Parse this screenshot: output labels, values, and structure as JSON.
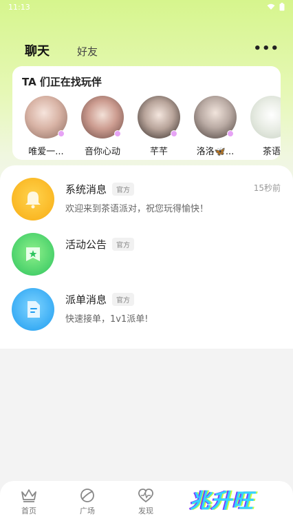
{
  "status_bar": {
    "time": "11:13"
  },
  "tabs": {
    "chat": "聊天",
    "friends": "好友"
  },
  "more_label": "•••",
  "find_card": {
    "title": "TA 们正在找玩伴",
    "people": [
      {
        "name": "唯爱一..."
      },
      {
        "name": "音你心动"
      },
      {
        "name": "芊芊"
      },
      {
        "name": "洛洛🦋..."
      },
      {
        "name": "茶语"
      }
    ]
  },
  "messages": [
    {
      "name": "系统消息",
      "tag": "官方",
      "text": "欢迎来到茶语派对，祝您玩得愉快！",
      "time": "15秒前",
      "icon": "bell-icon",
      "color": "#f8ac13"
    },
    {
      "name": "活动公告",
      "tag": "官方",
      "text": "",
      "time": "",
      "icon": "flag-icon",
      "color": "#2dc45e"
    },
    {
      "name": "派单消息",
      "tag": "官方",
      "text": "快速接单，1v1派单!",
      "time": "",
      "icon": "document-icon",
      "color": "#1d9cf0"
    }
  ],
  "bottom_nav": [
    {
      "label": "首页",
      "icon": "crown-icon"
    },
    {
      "label": "广场",
      "icon": "planet-icon"
    },
    {
      "label": "发现",
      "icon": "heartbeat-icon"
    }
  ],
  "brand": "兆升旺",
  "colors": {
    "accent": "#c7ef5d",
    "background": "#f3f3f3"
  }
}
